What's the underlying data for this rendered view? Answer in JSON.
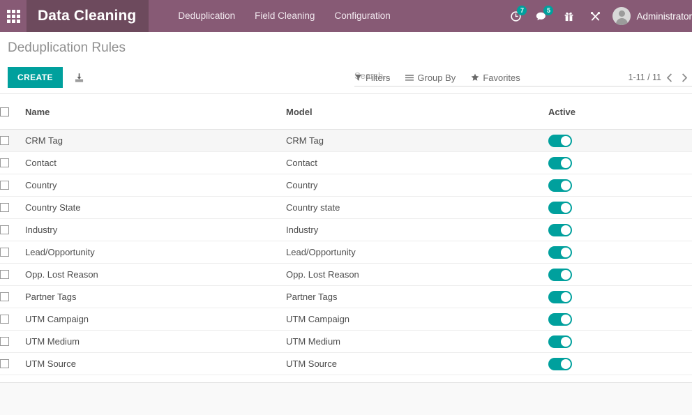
{
  "navbar": {
    "apps_icon": "apps-grid-icon",
    "brand_title": "Data Cleaning",
    "menu_items": [
      {
        "label": "Deduplication"
      },
      {
        "label": "Field Cleaning"
      },
      {
        "label": "Configuration"
      }
    ],
    "systray": [
      {
        "icon": "activity-clock-icon",
        "badge": "7"
      },
      {
        "icon": "messages-bubble-icon",
        "badge": "5"
      },
      {
        "icon": "gift-box-icon",
        "badge": ""
      },
      {
        "icon": "tools-cross-icon",
        "badge": ""
      }
    ],
    "user": {
      "avatar_icon": "user-avatar-icon",
      "name": "Administrator"
    }
  },
  "control_panel": {
    "breadcrumb": "Deduplication Rules",
    "create_label": "CREATE",
    "import_icon": "import-download-icon",
    "search": {
      "placeholder": "Search...",
      "value": ""
    },
    "filters": [
      {
        "label": "Filters",
        "icon": "funnel-icon"
      },
      {
        "label": "Group By",
        "icon": "hamburger-lines-icon"
      },
      {
        "label": "Favorites",
        "icon": "star-icon"
      }
    ],
    "pager": {
      "count": "1-11 / 11",
      "prev_icon": "chevron-left-icon",
      "next_icon": "chevron-right-icon"
    }
  },
  "list": {
    "columns": {
      "name": "Name",
      "model": "Model",
      "active": "Active"
    },
    "rows": [
      {
        "name": "CRM Tag",
        "model": "CRM Tag",
        "active": true
      },
      {
        "name": "Contact",
        "model": "Contact",
        "active": true
      },
      {
        "name": "Country",
        "model": "Country",
        "active": true
      },
      {
        "name": "Country State",
        "model": "Country state",
        "active": true
      },
      {
        "name": "Industry",
        "model": "Industry",
        "active": true
      },
      {
        "name": "Lead/Opportunity",
        "model": "Lead/Opportunity",
        "active": true
      },
      {
        "name": "Opp. Lost Reason",
        "model": "Opp. Lost Reason",
        "active": true
      },
      {
        "name": "Partner Tags",
        "model": "Partner Tags",
        "active": true
      },
      {
        "name": "UTM Campaign",
        "model": "UTM Campaign",
        "active": true
      },
      {
        "name": "UTM Medium",
        "model": "UTM Medium",
        "active": true
      },
      {
        "name": "UTM Source",
        "model": "UTM Source",
        "active": true
      }
    ]
  },
  "colors": {
    "brand_dark": "#6d4a5d",
    "brand_light": "#875a75",
    "accent_teal": "#00a09d",
    "page_background": "#f9f9f9"
  }
}
